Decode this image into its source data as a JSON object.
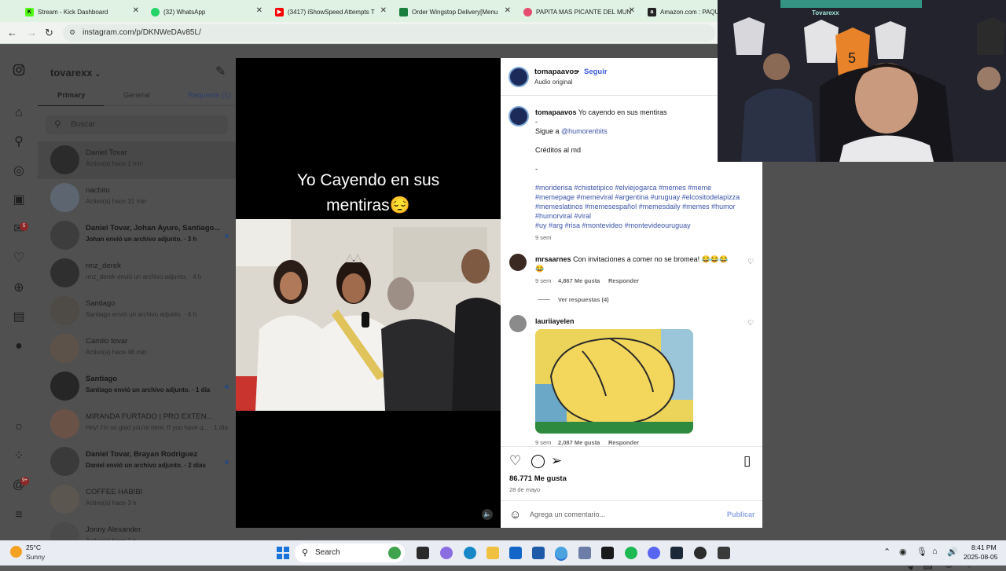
{
  "browser": {
    "tabs": [
      {
        "title": "Stream - Kick Dashboard",
        "fav_color": "#53fc18",
        "fav_text": "K"
      },
      {
        "title": "(32) WhatsApp",
        "fav_color": "#25d366",
        "fav_text": ""
      },
      {
        "title": "(3417) iShowSpeed Attempts T",
        "fav_color": "#ff0000",
        "fav_text": ""
      },
      {
        "title": "Order Wingstop Delivery[Menu",
        "fav_color": "#1a7f3c",
        "fav_text": ""
      },
      {
        "title": "PAPITA MAS PICANTE DEL MUN",
        "fav_color": "#e44d6e",
        "fav_text": ""
      },
      {
        "title": "Amazon.com : PAQU",
        "fav_color": "#222222",
        "fav_text": "a"
      }
    ],
    "url": "instagram.com/p/DKNWeDAv85L/"
  },
  "dm": {
    "username": "tovarexx",
    "tabs": {
      "primary": "Primary",
      "general": "General",
      "requests": "Requests (1)"
    },
    "search_placeholder": "Buscar",
    "conversations": [
      {
        "name": "Daniel Tovar",
        "sub": "Activo(a) hace 1 min",
        "unread": false,
        "selected": true,
        "avatar": "#2b2b2b"
      },
      {
        "name": "nachito",
        "sub": "Activo(a) hace 31 min",
        "unread": false,
        "selected": false,
        "avatar": "#5d6670"
      },
      {
        "name": "Daniel Tovar, Johan Ayure, Santiago...",
        "sub": "Johan envió un archivo adjunto. · 3 h",
        "unread": true,
        "selected": false,
        "avatar": "#3d3d3d"
      },
      {
        "name": "rmz_derek",
        "sub": "rmz_derek envió un archivo adjunto. · 4 h",
        "unread": false,
        "selected": false,
        "avatar": "#2f2f2f"
      },
      {
        "name": "Santiago",
        "sub": "Santiago envió un archivo adjunto. · 6 h",
        "unread": false,
        "selected": false,
        "avatar": "#4e4a45"
      },
      {
        "name": "Camilo tovar",
        "sub": "Activo(a) hace 48 min",
        "unread": false,
        "selected": false,
        "avatar": "#5c5249"
      },
      {
        "name": "Santiago",
        "sub": "Santiago envió un archivo adjunto. · 1 día",
        "unread": true,
        "selected": false,
        "avatar": "#262626"
      },
      {
        "name": "MIRANDA FURTADO | PRO EXTEN...",
        "sub": "Hey! I'm so glad you're here. If you have q... · 1 día",
        "unread": false,
        "selected": false,
        "avatar": "#6b5247"
      },
      {
        "name": "Daniel Tovar, Brayan Rodriguez",
        "sub": "Daniel envió un archivo adjunto. · 2 días",
        "unread": true,
        "selected": false,
        "avatar": "#3a3a3a"
      },
      {
        "name": "COFFEE HABIBI",
        "sub": "Activo(a) hace 3 h",
        "unread": false,
        "selected": false,
        "avatar": "#5b5650"
      },
      {
        "name": "Jonny Alexander",
        "sub": "Activo(a) hace 1 h",
        "unread": false,
        "selected": false,
        "avatar": "#4a4a4a"
      }
    ]
  },
  "video": {
    "caption_line1": "Yo Cayendo en sus",
    "caption_line2": "mentiras😔"
  },
  "post": {
    "author": "tomapaavos",
    "follow": "Seguir",
    "audio": "Audio original",
    "caption_title": "Yo cayendo en sus mentiras",
    "caption_dash": "-",
    "caption_follow_prefix": "Sigue a ",
    "caption_follow_handle": "@humorenbits",
    "caption_credits": "Créditos al md",
    "caption_dash2": "-",
    "hashtags": [
      "#moriderisa #chistetipico #elviejogarca #memes #meme",
      "#memepage #memeviral #argentina #uruguay #elcositodelapizza",
      "#memeslatinos #memesespañol #memesdaily #memes #humor",
      "#humorviral #viral",
      "#uy #arg #risa #montevideo #montevideouruguay"
    ],
    "caption_age": "9 sem",
    "comments": [
      {
        "user": "mrsaarnes",
        "text": "Con invitaciones a comer no se bromea! 😂😂😂",
        "text2": "😂",
        "age": "9 sem",
        "likes": "4,867 Me gusta",
        "reply": "Responder",
        "view_replies": "Ver respuestas (4)"
      },
      {
        "user": "lauriiayelen",
        "age": "9 sem",
        "likes": "2,087 Me gusta",
        "reply": "Responder"
      }
    ],
    "likes": "86.771 Me gusta",
    "date": "28 de mayo",
    "comment_placeholder": "Agrega un comentario...",
    "publish": "Publicar"
  },
  "webcam": {
    "label": "Tovarexx"
  },
  "taskbar": {
    "temp": "25°C",
    "condition": "Sunny",
    "search": "Search",
    "time": "8:41 PM",
    "date": "2025-08-05"
  },
  "colors": {
    "instagram_link": "#3b5bd9",
    "hashtag": "#3a55a8",
    "kick_green": "#53fc18"
  }
}
